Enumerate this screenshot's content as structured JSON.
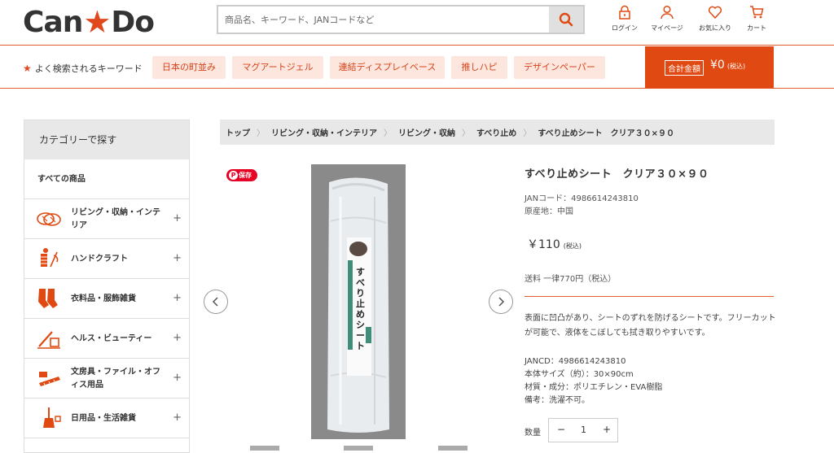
{
  "header": {
    "logo_left": "Can",
    "logo_star": "★",
    "logo_right": "Do",
    "search_placeholder": "商品名、キーワード、JANコードなど",
    "nav": [
      {
        "label": "ログイン",
        "icon": "lock-icon"
      },
      {
        "label": "マイページ",
        "icon": "user-icon"
      },
      {
        "label": "お気に入り",
        "icon": "heart-icon"
      },
      {
        "label": "カート",
        "icon": "cart-icon"
      }
    ]
  },
  "keywords": {
    "title": "よく検索されるキーワード",
    "items": [
      "日本の町並み",
      "マグアートジェル",
      "連結ディスプレイベース",
      "推しハピ",
      "デザインペーパー"
    ]
  },
  "cart_total": {
    "label": "合計金額",
    "amount": "¥0",
    "tax": "(税込)"
  },
  "sidebar": {
    "title": "カテゴリーで探す",
    "all_label": "すべての商品",
    "categories": [
      {
        "label": "リビング・収納・インテリア",
        "icon": "living-icon"
      },
      {
        "label": "ハンドクラフト",
        "icon": "craft-icon"
      },
      {
        "label": "衣料品・服飾雑貨",
        "icon": "socks-icon"
      },
      {
        "label": "ヘルス・ビューティー",
        "icon": "beauty-icon"
      },
      {
        "label": "文房具・ファイル・オフィス用品",
        "icon": "stationery-icon"
      },
      {
        "label": "日用品・生活雑貨",
        "icon": "broom-icon"
      }
    ]
  },
  "breadcrumb": [
    "トップ",
    "リビング・収納・インテリア",
    "リビング・収納",
    "すべり止め",
    "すべり止めシート　クリア３０×９０"
  ],
  "product": {
    "save_label": "保存",
    "title": "すべり止めシート　クリア３０×９０",
    "jan_line": "JANコード：4986614243810",
    "origin_line": "原産地：中国",
    "price": "￥110",
    "price_tax": "(税込)",
    "shipping": "送料 一律770円（税込）",
    "description": "表面に凹凸があり、シートのずれを防げるシートです。フリーカットが可能で、液体をこぼしても拭き取りやすいです。",
    "specs": [
      "JANCD：4986614243810",
      "本体サイズ（約）：30×90cm",
      "材質・成分：ポリエチレン・EVA樹脂",
      "備考：洗濯不可。"
    ],
    "qty_label": "数量",
    "qty_value": "1",
    "qty_minus": "−",
    "qty_plus": "+",
    "package_text": "すべり止めシート"
  },
  "colors": {
    "accent": "#e04a12",
    "keyword_bg": "#fde6dd",
    "keyword_text": "#d6441c",
    "pinterest": "#e60023"
  }
}
